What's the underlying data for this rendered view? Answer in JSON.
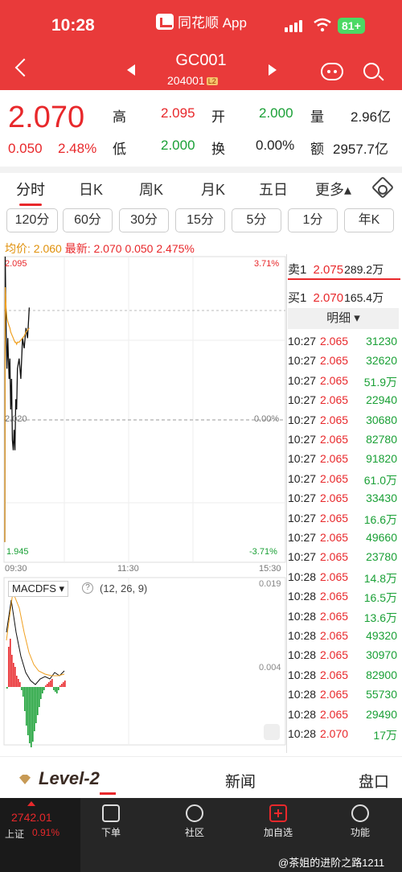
{
  "status_bar": {
    "time": "10:28",
    "app_name": "同花顺 App",
    "battery": "81+"
  },
  "header": {
    "code": "GC001",
    "sub_code": "204001",
    "badge": "L2"
  },
  "quote": {
    "price": "2.070",
    "change": "0.050",
    "change_pct": "2.48%",
    "high_label": "高",
    "high": "2.095",
    "low_label": "低",
    "low": "2.000",
    "open_label": "开",
    "open": "2.000",
    "turnover_label": "换",
    "turnover": "0.00%",
    "volume_label": "量",
    "volume": "2.96亿",
    "amount_label": "额",
    "amount": "2957.7亿"
  },
  "tabs": [
    "分时",
    "日K",
    "周K",
    "月K",
    "五日",
    "更多▴"
  ],
  "periods": [
    "120分",
    "60分",
    "30分",
    "15分",
    "5分",
    "1分",
    "年K"
  ],
  "info_line": {
    "avg_label": "均价:",
    "avg": "2.060",
    "latest_label": "最新:",
    "latest": "2.070",
    "chg": "0.050",
    "pct": "2.475%"
  },
  "chart_axis": {
    "price_top": "2.095",
    "price_mid": "2.020",
    "price_bottom": "1.945",
    "pct_top": "3.71%",
    "pct_mid": "0.00%",
    "pct_bottom": "-3.71%",
    "time_start": "09:30",
    "time_mid": "11:30",
    "time_end": "15:30",
    "macd_name": "MACDFS",
    "macd_params": "(12, 26, 9)",
    "macd_top": "0.019",
    "macd_mid": "0.004"
  },
  "chart_data": {
    "type": "line",
    "title": "",
    "x": [
      "09:30",
      "09:31",
      "09:33",
      "09:35",
      "09:37",
      "09:40",
      "09:42",
      "09:44",
      "09:46",
      "09:48",
      "09:50",
      "09:52",
      "09:54",
      "09:56",
      "09:58",
      "10:00",
      "10:04",
      "10:08",
      "10:12",
      "10:16",
      "10:20",
      "10:24",
      "10:28"
    ],
    "series": [
      {
        "values": [
          1.955,
          2.095,
          2.06,
          2.04,
          2.055,
          2.035,
          2.045,
          2.02,
          2.035,
          2.005,
          2.0,
          2.01,
          2.0,
          2.025,
          2.02,
          2.04,
          2.045,
          2.035,
          2.055,
          2.05,
          2.06,
          2.055,
          2.07
        ]
      },
      {
        "values": [
          1.955,
          2.08,
          2.07,
          2.065,
          2.063,
          2.061,
          2.06,
          2.058,
          2.057,
          2.056,
          2.055,
          2.054,
          2.053,
          2.053,
          2.052,
          2.053,
          2.053,
          2.054,
          2.055,
          2.056,
          2.058,
          2.059,
          2.06
        ]
      }
    ],
    "ylim": [
      1.945,
      2.095
    ],
    "xlabel": "",
    "ylabel": ""
  },
  "order_book": {
    "ask_label": "卖1",
    "ask_price": "2.075",
    "ask_vol": "289.2万",
    "bid_label": "买1",
    "bid_price": "2.070",
    "bid_vol": "165.4万",
    "detail_label": "明细 ▾"
  },
  "ticks": [
    {
      "t": "10:27",
      "p": "2.065",
      "v": "31230"
    },
    {
      "t": "10:27",
      "p": "2.065",
      "v": "32620"
    },
    {
      "t": "10:27",
      "p": "2.065",
      "v": "51.9万"
    },
    {
      "t": "10:27",
      "p": "2.065",
      "v": "22940"
    },
    {
      "t": "10:27",
      "p": "2.065",
      "v": "30680"
    },
    {
      "t": "10:27",
      "p": "2.065",
      "v": "82780"
    },
    {
      "t": "10:27",
      "p": "2.065",
      "v": "91820"
    },
    {
      "t": "10:27",
      "p": "2.065",
      "v": "61.0万"
    },
    {
      "t": "10:27",
      "p": "2.065",
      "v": "33430"
    },
    {
      "t": "10:27",
      "p": "2.065",
      "v": "16.6万"
    },
    {
      "t": "10:27",
      "p": "2.065",
      "v": "49660"
    },
    {
      "t": "10:27",
      "p": "2.065",
      "v": "23780"
    },
    {
      "t": "10:28",
      "p": "2.065",
      "v": "14.8万"
    },
    {
      "t": "10:28",
      "p": "2.065",
      "v": "16.5万"
    },
    {
      "t": "10:28",
      "p": "2.065",
      "v": "13.6万"
    },
    {
      "t": "10:28",
      "p": "2.065",
      "v": "49320"
    },
    {
      "t": "10:28",
      "p": "2.065",
      "v": "30970"
    },
    {
      "t": "10:28",
      "p": "2.065",
      "v": "82900"
    },
    {
      "t": "10:28",
      "p": "2.065",
      "v": "55730"
    },
    {
      "t": "10:28",
      "p": "2.065",
      "v": "29490"
    },
    {
      "t": "10:28",
      "p": "2.070",
      "v": "17万"
    }
  ],
  "bottom_tabs": {
    "level2": "Level-2",
    "news": "新闻",
    "book": "盘口"
  },
  "nav": {
    "index_value": "2742.01",
    "index_name": "上证",
    "index_pct": "0.91%",
    "items": [
      "下单",
      "社区",
      "加自选",
      "功能"
    ]
  },
  "watermark": "@茶姐的进阶之路1211",
  "colors": {
    "header": "#e93a3a",
    "up": "#e8282b",
    "down": "#1aa036",
    "avg_line": "#f0a020"
  }
}
